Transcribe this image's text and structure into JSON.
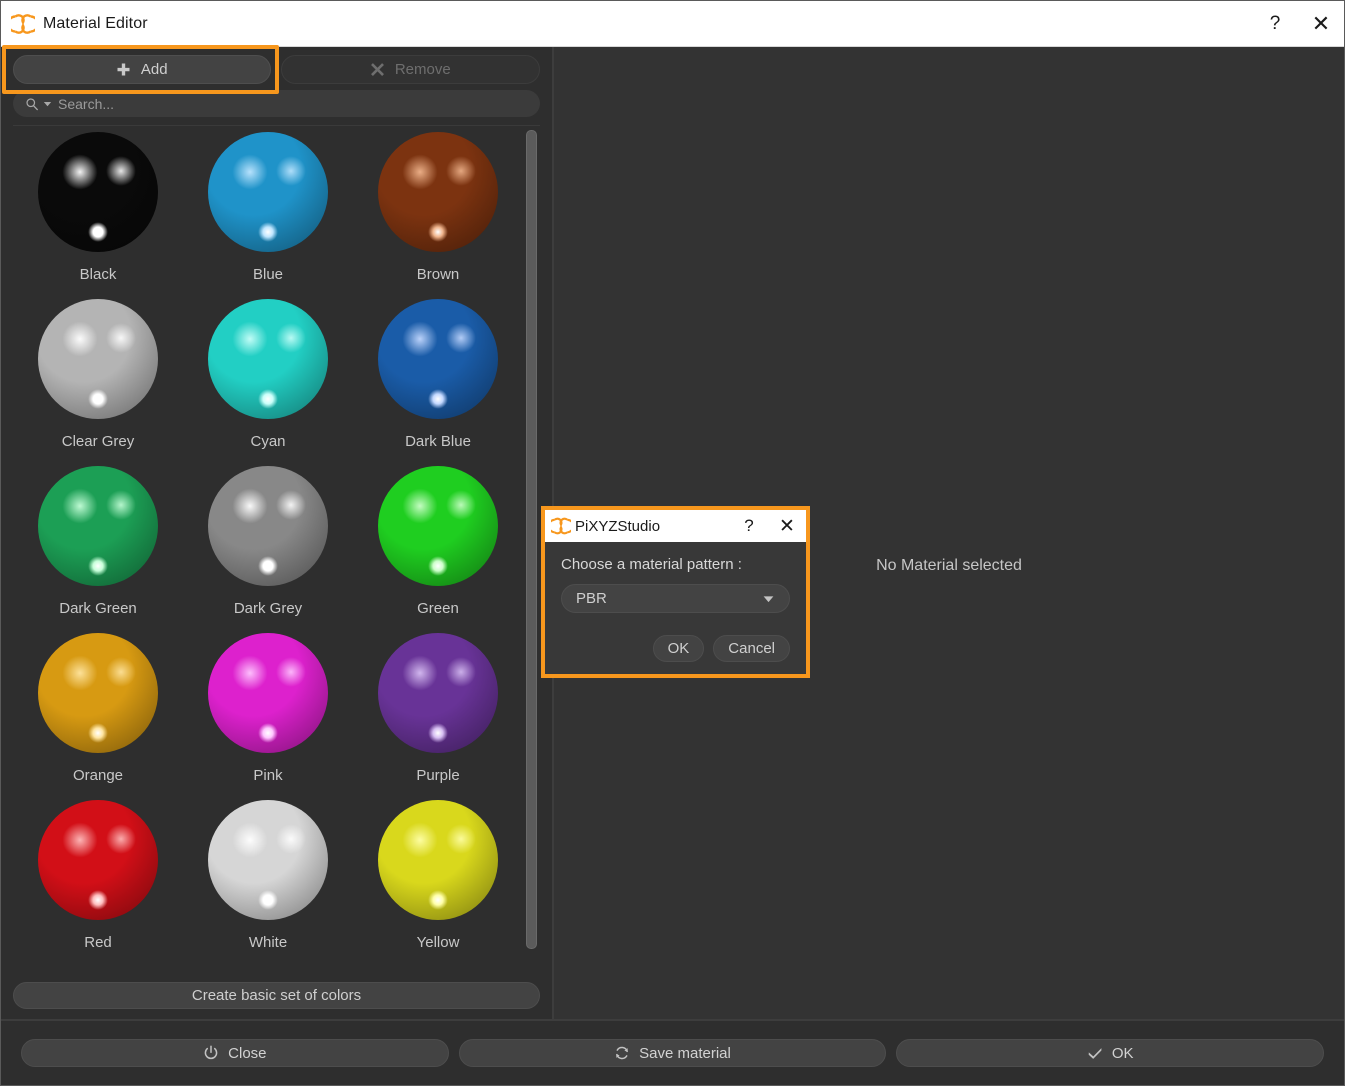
{
  "window": {
    "title": "Material Editor",
    "logo_icon": "pixyz-logo-icon",
    "help_label": "?",
    "close_label": "✕"
  },
  "toolbar": {
    "add_label": "Add",
    "add_icon": "plus-icon",
    "remove_label": "Remove",
    "remove_icon": "x-mark-icon",
    "highlight_color": "#f7971d"
  },
  "search": {
    "placeholder": "Search...",
    "value": "",
    "search_icon": "search-icon",
    "dropdown_icon": "caret-down-icon"
  },
  "materials": [
    {
      "label": "Black",
      "color": "#0a0a0a",
      "highlight": "#ffffff"
    },
    {
      "label": "Blue",
      "color": "#1f93c9",
      "highlight": "#bfe6ff"
    },
    {
      "label": "Brown",
      "color": "#7c3310",
      "highlight": "#f0b48c"
    },
    {
      "label": "Clear Grey",
      "color": "#b4b4b4",
      "highlight": "#ffffff"
    },
    {
      "label": "Cyan",
      "color": "#22cfc4",
      "highlight": "#c9fff9"
    },
    {
      "label": "Dark Blue",
      "color": "#1a5ca8",
      "highlight": "#c3d8ff"
    },
    {
      "label": "Dark Green",
      "color": "#1c9f55",
      "highlight": "#c6ffd9"
    },
    {
      "label": "Dark Grey",
      "color": "#888888",
      "highlight": "#ffffff"
    },
    {
      "label": "Green",
      "color": "#1fce20",
      "highlight": "#ccffc9"
    },
    {
      "label": "Orange",
      "color": "#d79a12",
      "highlight": "#ffe5a0"
    },
    {
      "label": "Pink",
      "color": "#dd21cd",
      "highlight": "#ffc6ff"
    },
    {
      "label": "Purple",
      "color": "#683397",
      "highlight": "#d6bdf2"
    },
    {
      "label": "Red",
      "color": "#d20f17",
      "highlight": "#ffbdbd"
    },
    {
      "label": "White",
      "color": "#d6d6d6",
      "highlight": "#ffffff"
    },
    {
      "label": "Yellow",
      "color": "#d9d81c",
      "highlight": "#ffffa8"
    }
  ],
  "create_set": {
    "label": "Create basic set of colors"
  },
  "preview": {
    "empty_text": "No Material selected"
  },
  "bottom": {
    "close_label": "Close",
    "close_icon": "power-icon",
    "save_label": "Save material",
    "save_icon": "refresh-icon",
    "ok_label": "OK",
    "ok_icon": "check-icon"
  },
  "dialog": {
    "title": "PiXYZStudio",
    "logo_icon": "pixyz-logo-icon",
    "help_label": "?",
    "close_label": "✕",
    "prompt": "Choose a material pattern :",
    "select_value": "PBR",
    "select_icon": "caret-down-icon",
    "ok_label": "OK",
    "cancel_label": "Cancel",
    "highlight_color": "#f7971d"
  }
}
